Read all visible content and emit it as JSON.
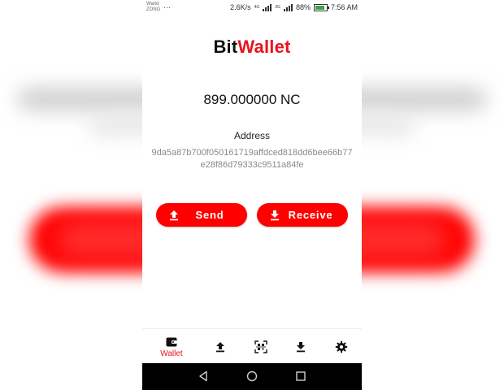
{
  "status_bar": {
    "carrier_lines": [
      "Warid",
      "ZONG"
    ],
    "more": "···",
    "speed": "2.6K/s",
    "network_badges": [
      "4G",
      "3G"
    ],
    "battery": "88%",
    "time": "7:56 AM"
  },
  "app": {
    "logo_part1": "Bit",
    "logo_part2": "Wallet",
    "brand_color": "#e8141e"
  },
  "wallet": {
    "balance": "899.000000 NC",
    "address_label": "Address",
    "address": "9da5a87b700f050161719affdced818dd6bee66b77e28f86d79333c9511a84fe"
  },
  "actions": {
    "send_label": "Send",
    "receive_label": "Receive",
    "send_icon": "upload-icon",
    "receive_icon": "download-icon"
  },
  "bottom_nav": {
    "items": [
      {
        "icon": "wallet-icon",
        "label": "Wallet",
        "active": true
      },
      {
        "icon": "upload-icon",
        "label": ""
      },
      {
        "icon": "qr-scan-icon",
        "label": ""
      },
      {
        "icon": "download-icon",
        "label": ""
      },
      {
        "icon": "gear-icon",
        "label": ""
      }
    ]
  },
  "system_nav": {
    "icons": [
      "back-icon",
      "home-icon",
      "recents-icon"
    ]
  }
}
